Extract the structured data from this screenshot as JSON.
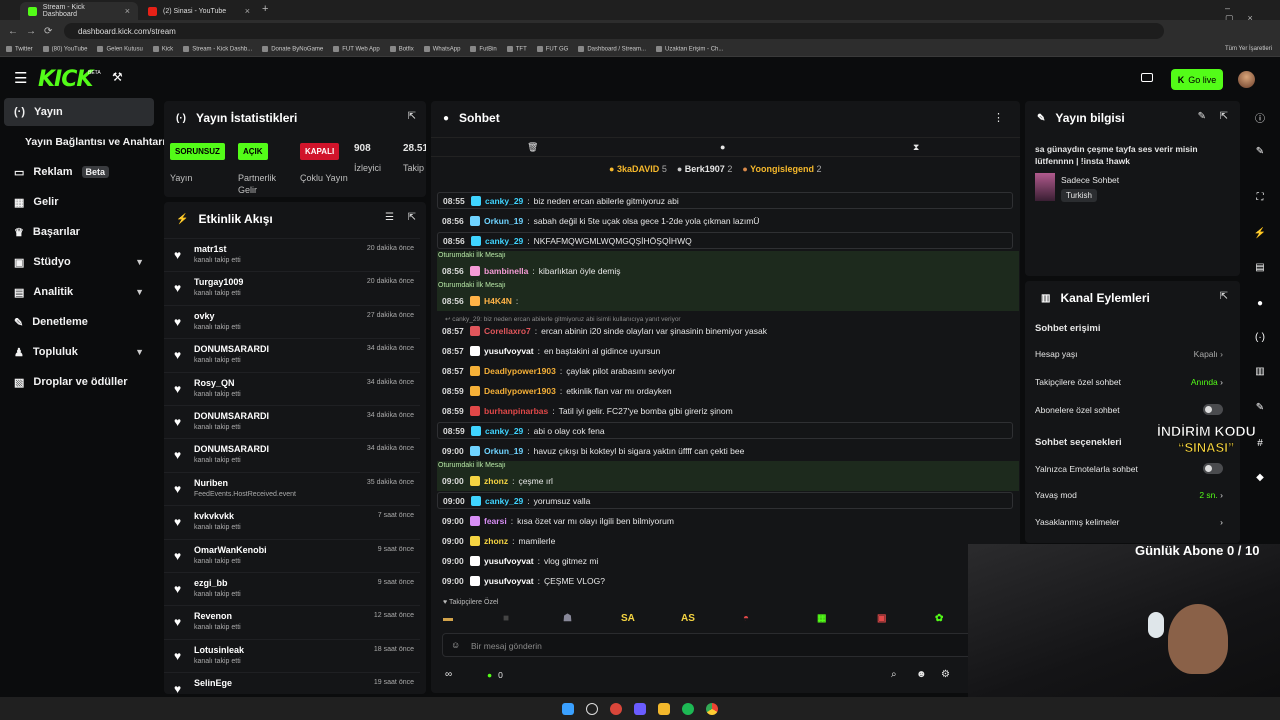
{
  "browser": {
    "tabs": [
      {
        "label": "Stream - Kick Dashboard"
      },
      {
        "label": "(2) Sinasi - YouTube"
      }
    ],
    "url": "dashboard.kick.com/stream",
    "bookmarks": [
      "Twitter",
      "(80) YouTube",
      "Gelen Kutusu",
      "Kick",
      "Stream - Kick Dashb...",
      "Donate ByNoGame",
      "FUT Web App",
      "Botfix",
      "WhatsApp",
      "FutBin",
      "TFT",
      "FUT GG",
      "Dashboard / Stream...",
      "Uzaktan Erişim - Ch..."
    ],
    "all_bookmarks": "Tüm Yer İşaretleri"
  },
  "header": {
    "logo": "KICK",
    "logo_sup": "BETA",
    "go_live": "Go live"
  },
  "sidebar": {
    "items": [
      {
        "label": "Yayın",
        "icon": "broadcast-icon"
      },
      {
        "label": "Yayın Bağlantısı ve Anahtarı"
      },
      {
        "label": "Reklam",
        "icon": "ads-icon",
        "badge": "Beta"
      },
      {
        "label": "Gelir",
        "icon": "grid-icon"
      },
      {
        "label": "Başarılar",
        "icon": "trophy-icon"
      },
      {
        "label": "Stüdyo",
        "icon": "studio-icon"
      },
      {
        "label": "Analitik",
        "icon": "chart-icon"
      },
      {
        "label": "Denetleme",
        "icon": "wrench-icon"
      },
      {
        "label": "Topluluk",
        "icon": "community-icon"
      },
      {
        "label": "Droplar ve ödüller",
        "icon": "drop-icon"
      }
    ]
  },
  "stats": {
    "title": "Yayın İstatistikleri",
    "items": [
      {
        "pill": "SORUNSUZ",
        "label": "Yayın",
        "color": "#53fc18"
      },
      {
        "pill": "AÇIK",
        "label": "Partnerlik Gelir Programı",
        "color": "#53fc18"
      },
      {
        "pill": "KAPALI",
        "label": "Çoklu Yayın",
        "color": "#d1142b"
      },
      {
        "value": "908",
        "label": "İzleyici"
      },
      {
        "value": "28.51",
        "label": "Takip"
      }
    ]
  },
  "feed": {
    "title": "Etkinlik Akışı",
    "items": [
      {
        "name": "matr1st",
        "sub": "kanalı takip etti",
        "time": "20 dakika önce"
      },
      {
        "name": "Turgay1009",
        "sub": "kanalı takip etti",
        "time": "20 dakika önce"
      },
      {
        "name": "ovky",
        "sub": "kanalı takip etti",
        "time": "27 dakika önce"
      },
      {
        "name": "DONUMSARARDI",
        "sub": "kanalı takip etti",
        "time": "34 dakika önce"
      },
      {
        "name": "Rosy_QN",
        "sub": "kanalı takip etti",
        "time": "34 dakika önce"
      },
      {
        "name": "DONUMSARARDI",
        "sub": "kanalı takip etti",
        "time": "34 dakika önce"
      },
      {
        "name": "DONUMSARARDI",
        "sub": "kanalı takip etti",
        "time": "34 dakika önce"
      },
      {
        "name": "Nuriben",
        "sub": "FeedEvents.HostReceived.event",
        "time": "35 dakika önce"
      },
      {
        "name": "kvkvkvkk",
        "sub": "kanalı takip etti",
        "time": "7 saat önce"
      },
      {
        "name": "OmarWanKenobi",
        "sub": "kanalı takip etti",
        "time": "9 saat önce"
      },
      {
        "name": "ezgi_bb",
        "sub": "kanalı takip etti",
        "time": "9 saat önce"
      },
      {
        "name": "Revenon",
        "sub": "kanalı takip etti",
        "time": "12 saat önce"
      },
      {
        "name": "Lotusinleak",
        "sub": "kanalı takip etti",
        "time": "18 saat önce"
      },
      {
        "name": "SelinEge",
        "sub": "",
        "time": "19 saat önce"
      }
    ]
  },
  "chat": {
    "title": "Sohbet",
    "leaders": [
      {
        "name": "3kaDAVID",
        "n": "5"
      },
      {
        "name": "Berk1907",
        "n": "2"
      },
      {
        "name": "Yoongislegend",
        "n": "2"
      }
    ],
    "first_msg_label": "Oturumdaki İlk Mesajı",
    "reply_ctx": "canky_29: biz neden ercan abilerle gitmiyoruz abi isimli kullanıcıya yanıt veriyor",
    "messages": [
      {
        "time": "08:55",
        "user": "canky_29",
        "text": "biz neden ercan abilerle gitmiyoruz abi",
        "color": "#3fd4ff",
        "hl": true
      },
      {
        "time": "08:56",
        "user": "Orkun_19",
        "text": "sabah değil ki 5te uçak olsa gece 1-2de yola çıkman lazımÜ",
        "color": "#6fd3ff"
      },
      {
        "time": "08:56",
        "user": "canky_29",
        "text": "NKFAFMQWGMLWQMGQŞİHÖŞQİHWQ",
        "color": "#3fd4ff",
        "hl": true
      },
      {
        "time": "08:56",
        "user": "bambinella",
        "text": "kibarlıktan öyle demiş",
        "color": "#f59bd6"
      },
      {
        "time": "08:56",
        "user": "H4K4N",
        "text": "",
        "color": "#ffb347"
      },
      {
        "time": "08:57",
        "user": "Corellaxro7",
        "text": "ercan abinin i20 sinde olayları var şinasinin binemiyor yasak",
        "color": "#e0565b"
      },
      {
        "time": "08:57",
        "user": "yusufvoyvat",
        "text": "en baştakini al gidince uyursun",
        "color": "#ffffff"
      },
      {
        "time": "08:57",
        "user": "Deadlypower1903",
        "text": "çaylak pilot arabasını seviyor",
        "color": "#f5b038"
      },
      {
        "time": "08:59",
        "user": "Deadlypower1903",
        "text": "etkinlik flan var mı ordayken",
        "color": "#f5b038"
      },
      {
        "time": "08:59",
        "user": "burhanpinarbas",
        "text": "Tatil iyi gelir. FC27'ye bomba gibi gireriz şinom",
        "color": "#e04848"
      },
      {
        "time": "08:59",
        "user": "canky_29",
        "text": "abi o olay cok fena",
        "color": "#3fd4ff",
        "hl": true
      },
      {
        "time": "09:00",
        "user": "Orkun_19",
        "text": "havuz çıkışı bi kokteyl bi sigara yaktın üffff can çekti bee",
        "color": "#6fd3ff"
      },
      {
        "time": "09:00",
        "user": "zhonz",
        "text": "çeşme ırl",
        "color": "#f5d442"
      },
      {
        "time": "09:00",
        "user": "canky_29",
        "text": "yorumsuz valla",
        "color": "#3fd4ff",
        "hl": true
      },
      {
        "time": "09:00",
        "user": "fearsi",
        "text": "kısa özet var mı olayı ilgili ben bilmiyorum",
        "color": "#d88ef5"
      },
      {
        "time": "09:00",
        "user": "zhonz",
        "text": "mamilerle",
        "color": "#f5d442"
      },
      {
        "time": "09:00",
        "user": "yusufvoyvat",
        "text": "vlog gitmez mi",
        "color": "#ffffff"
      },
      {
        "time": "09:00",
        "user": "yusufvoyvat",
        "text": "ÇEŞME VLOG?",
        "color": "#ffffff"
      }
    ],
    "followers_only": "Takipçilere Özel",
    "emotes": [
      "SA",
      "AS"
    ],
    "input_placeholder": "Bir mesaj gönderin",
    "counter": "0"
  },
  "stream_info": {
    "title": "Yayın bilgisi",
    "text": "sa günaydın çeşme tayfa ses verir misin lütfennnn | !insta !hawk",
    "category": "Sadece Sohbet",
    "lang": "Turkish"
  },
  "channel_actions": {
    "title": "Kanal Eylemleri",
    "chat_access": "Sohbet erişimi",
    "account_age": {
      "label": "Hesap yaşı",
      "value": "Kapalı"
    },
    "followers_chat": {
      "label": "Takipçilere özel sohbet",
      "value": "Anında"
    },
    "subs_chat": "Abonelere özel sohbet",
    "chat_options": "Sohbet seçenekleri",
    "emote_only": "Yalnızca Emotelarla sohbet",
    "slow_mode": {
      "label": "Yavaş mod",
      "value": "2 sn."
    },
    "banned_words": "Yasaklanmış kelimeler"
  },
  "overlay": {
    "promo_line1": "İNDİRİM KODU",
    "promo_line2": "“SINASI”",
    "subs_goal": "Günlük Abone 0 / 10"
  }
}
